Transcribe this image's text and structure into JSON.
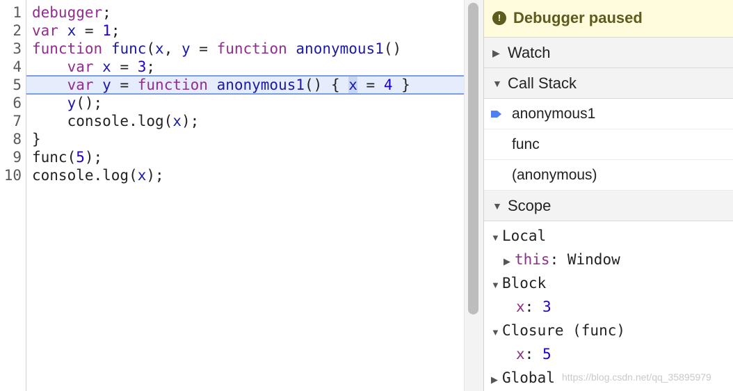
{
  "editor": {
    "line_numbers": [
      "1",
      "2",
      "3",
      "4",
      "5",
      "6",
      "7",
      "8",
      "9",
      "10"
    ],
    "lines": [
      [
        {
          "t": "debugger",
          "c": "kw"
        },
        {
          "t": ";",
          "c": ""
        }
      ],
      [
        {
          "t": "var",
          "c": "kw"
        },
        {
          "t": " ",
          "c": ""
        },
        {
          "t": "x",
          "c": "vr"
        },
        {
          "t": " = ",
          "c": ""
        },
        {
          "t": "1",
          "c": "nm"
        },
        {
          "t": ";",
          "c": ""
        }
      ],
      [
        {
          "t": "function",
          "c": "kw"
        },
        {
          "t": " ",
          "c": ""
        },
        {
          "t": "func",
          "c": "fn"
        },
        {
          "t": "(",
          "c": ""
        },
        {
          "t": "x",
          "c": "vr"
        },
        {
          "t": ", ",
          "c": ""
        },
        {
          "t": "y",
          "c": "vr"
        },
        {
          "t": " = ",
          "c": ""
        },
        {
          "t": "function",
          "c": "kw"
        },
        {
          "t": " ",
          "c": ""
        },
        {
          "t": "anonymous1",
          "c": "fn"
        },
        {
          "t": "()",
          "c": ""
        }
      ],
      [
        {
          "t": "    ",
          "c": ""
        },
        {
          "t": "var",
          "c": "kw"
        },
        {
          "t": " ",
          "c": ""
        },
        {
          "t": "x",
          "c": "vr"
        },
        {
          "t": " = ",
          "c": ""
        },
        {
          "t": "3",
          "c": "nm"
        },
        {
          "t": ";",
          "c": ""
        }
      ],
      [
        {
          "t": "    ",
          "c": ""
        },
        {
          "t": "var",
          "c": "kw"
        },
        {
          "t": " ",
          "c": ""
        },
        {
          "t": "y",
          "c": "vr"
        },
        {
          "t": " = ",
          "c": ""
        },
        {
          "t": "function",
          "c": "kw"
        },
        {
          "t": " ",
          "c": ""
        },
        {
          "t": "anonymous1",
          "c": "fn"
        },
        {
          "t": "() { ",
          "c": ""
        },
        {
          "t": "x",
          "c": "vr sel"
        },
        {
          "t": " = ",
          "c": ""
        },
        {
          "t": "4",
          "c": "nm"
        },
        {
          "t": " }",
          "c": ""
        }
      ],
      [
        {
          "t": "    ",
          "c": ""
        },
        {
          "t": "y",
          "c": "vr"
        },
        {
          "t": "();",
          "c": ""
        }
      ],
      [
        {
          "t": "    console.",
          "c": ""
        },
        {
          "t": "log",
          "c": ""
        },
        {
          "t": "(",
          "c": ""
        },
        {
          "t": "x",
          "c": "vr"
        },
        {
          "t": ");",
          "c": ""
        }
      ],
      [
        {
          "t": "}",
          "c": ""
        }
      ],
      [
        {
          "t": "func(",
          "c": ""
        },
        {
          "t": "5",
          "c": "nm"
        },
        {
          "t": ");",
          "c": ""
        }
      ],
      [
        {
          "t": "console.log(",
          "c": ""
        },
        {
          "t": "x",
          "c": "vr"
        },
        {
          "t": ");",
          "c": ""
        }
      ]
    ],
    "paused_line": 5
  },
  "banner": {
    "icon": "pause-info-icon",
    "text": "Debugger paused"
  },
  "watch": {
    "label": "Watch",
    "expanded": false
  },
  "call_stack": {
    "label": "Call Stack",
    "expanded": true,
    "frames": [
      "anonymous1",
      "func",
      "(anonymous)"
    ],
    "current_frame_icon": "current-frame-arrow-icon"
  },
  "scope": {
    "label": "Scope",
    "expanded": true,
    "local_label": "Local",
    "this_key": "this",
    "this_value": "Window",
    "block_label": "Block",
    "block_key": "x",
    "block_value": "3",
    "closure_label": "Closure (func)",
    "closure_key": "x",
    "closure_value": "5",
    "global_label": "Global"
  },
  "watermark": "https://blog.csdn.net/qq_35895979",
  "colors": {
    "keyword": "#8f2e8c",
    "variable": "#1a1aa6",
    "number": "#1c00cf",
    "banner_bg": "#fffbdc",
    "banner_text": "#5c5c1f",
    "paused_line_bg": "#e5ecfb",
    "frame_arrow": "#4f7ff0"
  }
}
